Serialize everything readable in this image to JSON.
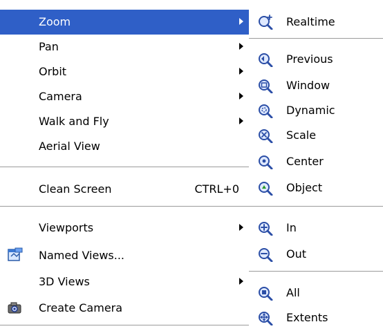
{
  "view_menu": {
    "items": [
      {
        "label": "Zoom"
      },
      {
        "label": "Pan"
      },
      {
        "label": "Orbit"
      },
      {
        "label": "Camera"
      },
      {
        "label": "Walk and Fly"
      },
      {
        "label": "Aerial View"
      },
      {
        "label": "Clean Screen",
        "shortcut": "CTRL+0"
      },
      {
        "label": "Viewports"
      },
      {
        "label": "Named Views..."
      },
      {
        "label": "3D Views"
      },
      {
        "label": "Create Camera"
      }
    ]
  },
  "zoom_submenu": {
    "items": [
      {
        "label": "Realtime"
      },
      {
        "label": "Previous"
      },
      {
        "label": "Window"
      },
      {
        "label": "Dynamic"
      },
      {
        "label": "Scale"
      },
      {
        "label": "Center"
      },
      {
        "label": "Object"
      },
      {
        "label": "In"
      },
      {
        "label": "Out"
      },
      {
        "label": "All"
      },
      {
        "label": "Extents"
      }
    ]
  },
  "colors": {
    "highlight": "#2f5fc7"
  }
}
